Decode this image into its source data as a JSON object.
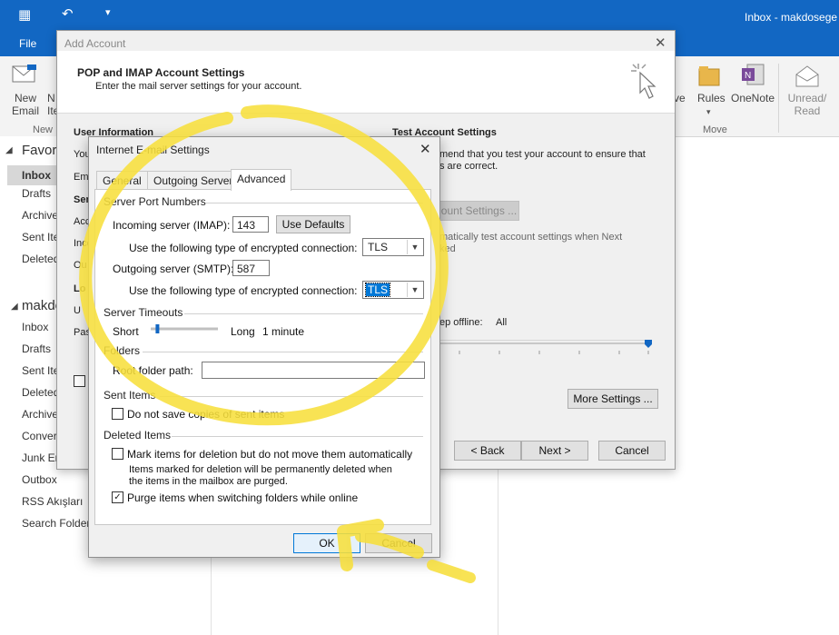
{
  "outlook": {
    "title": "Inbox - makdosege",
    "file_tab": "File",
    "ribbon": {
      "new_email": [
        "New",
        "Email"
      ],
      "new_items": [
        "N",
        "Ite"
      ],
      "group_new": "New",
      "move_partial": "ve",
      "rules": "Rules",
      "onenote": "OneNote",
      "group_move": "Move",
      "unread_read": [
        "Unread/",
        "Read"
      ]
    },
    "favorites_header": "Favori",
    "favorites": [
      "Inbox",
      "Drafts",
      "Archive",
      "Sent Ite",
      "Deleted"
    ],
    "account_header": "makdo",
    "account_folders": [
      "Inbox",
      "Drafts",
      "Sent Ite",
      "Deleted",
      "Archive",
      "Conver",
      "Junk En",
      "Outbox",
      "RSS Akışları",
      "Search Folders"
    ]
  },
  "add_account": {
    "window_title": "Add Account",
    "heading": "POP and IMAP Account Settings",
    "subheading": "Enter the mail server settings for your account.",
    "user_info": "User Information",
    "left_labels": [
      "You",
      "Ema",
      "Ser",
      "Acc",
      "Inco",
      "Ou",
      "Lo",
      "U",
      "Pas"
    ],
    "test_heading": "Test Account Settings",
    "test_text_1": "mend that you test your account to ensure that",
    "test_text_2": "s are correct.",
    "test_button": "ount Settings ...",
    "auto_test_1": "matically test account settings when Next",
    "auto_test_2": "ked",
    "keep_offline_label": "ep offline:",
    "keep_offline_value": "All",
    "more_settings": "More Settings ...",
    "back_button": "< Back",
    "next_button": "Next >",
    "cancel_button": "Cancel"
  },
  "ies": {
    "title": "Internet E-mail Settings",
    "tabs": [
      "General",
      "Outgoing Server",
      "Advanced"
    ],
    "server_port_numbers": "Server Port Numbers",
    "incoming_label": "Incoming server (IMAP):",
    "incoming_port": "143",
    "use_defaults": "Use Defaults",
    "enc_label": "Use the following type of encrypted connection:",
    "incoming_enc": "TLS",
    "outgoing_label": "Outgoing server (SMTP):",
    "outgoing_port": "587",
    "outgoing_enc": "TLS",
    "server_timeouts": "Server Timeouts",
    "short": "Short",
    "long": "Long",
    "timeout_value": "1 minute",
    "timeout_level": 0.05,
    "folders": "Folders",
    "root_folder_label": "Root folder path:",
    "root_folder_value": "",
    "sent_items": "Sent Items",
    "do_not_save": "Do not save copies of sent items",
    "do_not_save_checked": false,
    "deleted_items": "Deleted Items",
    "mark_items": "Mark items for deletion but do not move them automatically",
    "mark_items_checked": false,
    "mark_note_1": "Items marked for deletion will be permanently deleted when",
    "mark_note_2": "the items in the mailbox are purged.",
    "purge": "Purge items when switching folders while online",
    "purge_checked": true,
    "ok": "OK",
    "cancel": "Cancel"
  },
  "colors": {
    "outlook_blue": "#1267c3",
    "highlight_yellow": "#f7df3c"
  }
}
